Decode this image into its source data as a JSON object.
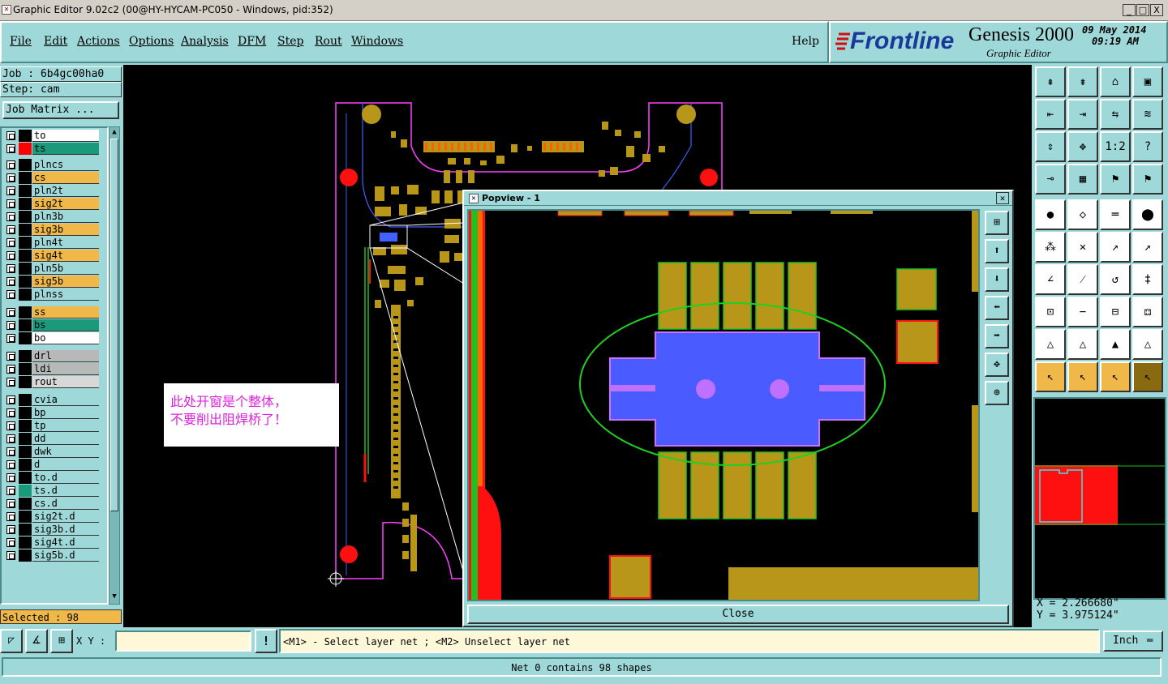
{
  "window": {
    "title": "Graphic Editor 9.02c2 (00@HY-HYCAM-PC050 - Windows, pid:352)",
    "controls": [
      "_",
      "□",
      "X"
    ]
  },
  "menu": {
    "items": [
      "File",
      "Edit",
      "Actions",
      "Options",
      "Analysis",
      "DFM",
      "Step",
      "Rout",
      "Windows"
    ],
    "help": "Help"
  },
  "brand": {
    "logo": "Frontline",
    "product": "Genesis 2000",
    "subtitle": "Graphic Editor",
    "date": "09 May 2014",
    "time": "09:19 AM"
  },
  "job": {
    "job_line": "Job : 6b4gc00ha0",
    "step_line": "Step: cam",
    "matrix_button": "Job Matrix ..."
  },
  "layers": [
    {
      "name": "to",
      "color": "#ffffff",
      "swatch": "#000000"
    },
    {
      "name": "ts",
      "color": "#1a9a7a",
      "swatch": "#ff0000"
    },
    {
      "name": "plncs",
      "color": "#9ed8d8",
      "swatch": "#000000"
    },
    {
      "name": "cs",
      "color": "#f0b848",
      "swatch": "#000000"
    },
    {
      "name": "pln2t",
      "color": "#9ed8d8",
      "swatch": "#000000"
    },
    {
      "name": "sig2t",
      "color": "#f0b848",
      "swatch": "#000000"
    },
    {
      "name": "pln3b",
      "color": "#9ed8d8",
      "swatch": "#000000"
    },
    {
      "name": "sig3b",
      "color": "#f0b848",
      "swatch": "#000000"
    },
    {
      "name": "pln4t",
      "color": "#9ed8d8",
      "swatch": "#000000"
    },
    {
      "name": "sig4t",
      "color": "#f0b848",
      "swatch": "#000000"
    },
    {
      "name": "pln5b",
      "color": "#9ed8d8",
      "swatch": "#000000"
    },
    {
      "name": "sig5b",
      "color": "#f0b848",
      "swatch": "#000000"
    },
    {
      "name": "plnss",
      "color": "#9ed8d8",
      "swatch": "#000000"
    },
    {
      "name": "ss",
      "color": "#f0b848",
      "swatch": "#000000"
    },
    {
      "name": "bs",
      "color": "#1a9a7a",
      "swatch": "#000000"
    },
    {
      "name": "bo",
      "color": "#ffffff",
      "swatch": "#000000"
    },
    {
      "name": "drl",
      "color": "#b8b8b8",
      "swatch": "#000000"
    },
    {
      "name": "ldi",
      "color": "#b8b8b8",
      "swatch": "#000000"
    },
    {
      "name": "rout",
      "color": "#d8d8d8",
      "swatch": "#000000"
    },
    {
      "name": "cvia",
      "color": "#9ed8d8",
      "swatch": "#000000"
    },
    {
      "name": "bp",
      "color": "#9ed8d8",
      "swatch": "#000000"
    },
    {
      "name": "tp",
      "color": "#9ed8d8",
      "swatch": "#000000"
    },
    {
      "name": "dd",
      "color": "#9ed8d8",
      "swatch": "#000000"
    },
    {
      "name": "dwk",
      "color": "#9ed8d8",
      "swatch": "#000000"
    },
    {
      "name": "d",
      "color": "#9ed8d8",
      "swatch": "#000000"
    },
    {
      "name": "to.d",
      "color": "#9ed8d8",
      "swatch": "#000000"
    },
    {
      "name": "ts.d",
      "color": "#9ed8d8",
      "swatch": "#1a9a7a"
    },
    {
      "name": "cs.d",
      "color": "#9ed8d8",
      "swatch": "#000000"
    },
    {
      "name": "sig2t.d",
      "color": "#9ed8d8",
      "swatch": "#000000"
    },
    {
      "name": "sig3b.d",
      "color": "#9ed8d8",
      "swatch": "#000000"
    },
    {
      "name": "sig4t.d",
      "color": "#9ed8d8",
      "swatch": "#000000"
    },
    {
      "name": "sig5b.d",
      "color": "#9ed8d8",
      "swatch": "#000000"
    }
  ],
  "selected": "Selected : 98",
  "annotation": {
    "line1": "此处开窗是个整体，",
    "line2": "不要削出阻焊桥了！"
  },
  "popview": {
    "title": "Popview - 1",
    "close_label": "Close"
  },
  "coords": {
    "x": "X = 2.266680\"",
    "y": "Y = 3.975124\""
  },
  "xy_label": "X Y :",
  "xy_value": "",
  "hint": "<M1> - Select layer net ; <M2> Unselect layer net",
  "units": "Inch",
  "status": "Net 0 contains 98 shapes"
}
